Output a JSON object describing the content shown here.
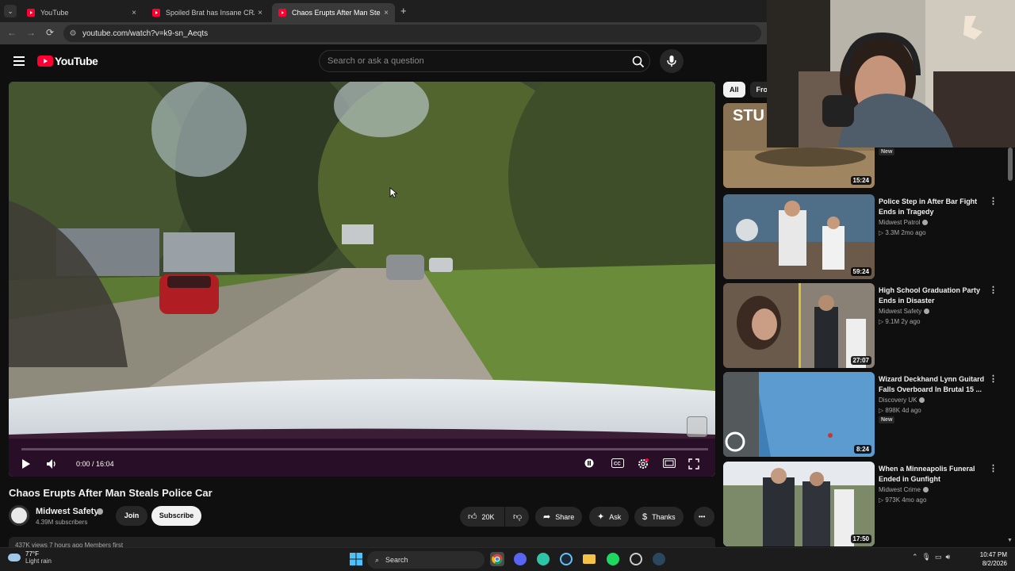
{
  "browser": {
    "tabs": [
      {
        "title": "YouTube",
        "close": "×",
        "active": false
      },
      {
        "title": "Spoiled Brat has Insane CRASH",
        "close": "×",
        "active": false
      },
      {
        "title": "Chaos Erupts After Man Steals F",
        "close": "×",
        "active": true
      }
    ],
    "tab_menu": "⌄",
    "new_tab": "+",
    "url": "youtube.com/watch?v=k9-sn_Aeqts",
    "nav": {
      "back": "←",
      "forward": "→",
      "reload": "⟳"
    }
  },
  "header": {
    "logo_text": "YouTube",
    "search_placeholder": "Search or ask a question"
  },
  "player": {
    "current_time": "0:00",
    "separator": " / ",
    "duration": "16:04",
    "progress_fraction": 0.0
  },
  "video": {
    "title": "Chaos Erupts After Man Steals Police Car",
    "channel": "Midwest Safety",
    "subscribers": "4.39M subscribers",
    "join_label": "Join",
    "subscribe_label": "Subscribe",
    "likes": "20K",
    "share_label": "Share",
    "ask_label": "Ask",
    "thanks_label": "Thanks",
    "more_label": "•••",
    "description_peek": "437K views  7 hours ago  Members first"
  },
  "chips": [
    "All",
    "Fro"
  ],
  "recommendations": [
    {
      "thumb_text": "STU",
      "duration": "15:24",
      "title": "",
      "channel": "",
      "meta": "",
      "badge": "New"
    },
    {
      "duration": "59:24",
      "title": "Police Step in After Bar Fight Ends in Tragedy",
      "channel": "Midwest Patrol",
      "meta": "3.3M  2mo ago",
      "badge": ""
    },
    {
      "duration": "27:07",
      "title": "High School Graduation Party Ends in Disaster",
      "channel": "Midwest Safety",
      "meta": "9.1M  2y ago",
      "badge": ""
    },
    {
      "duration": "8:24",
      "title": "Wizard Deckhand Lynn Guitard Falls Overboard In Brutal 15 ...",
      "channel": "Discovery UK",
      "meta": "898K  4d ago",
      "badge": "New"
    },
    {
      "duration": "17:50",
      "title": "When a Minneapolis Funeral Ended in Gunfight",
      "channel": "Midwest Crime",
      "meta": "973K  4mo ago",
      "badge": ""
    }
  ],
  "taskbar": {
    "temperature": "77°F",
    "condition": "Light rain",
    "search_label": "Search",
    "time": "10:47 PM",
    "date": "8/2/2026"
  },
  "colors": {
    "youtube_red": "#ff0033",
    "background": "#0f0f0f",
    "chip_active": "#f1f1f1"
  }
}
